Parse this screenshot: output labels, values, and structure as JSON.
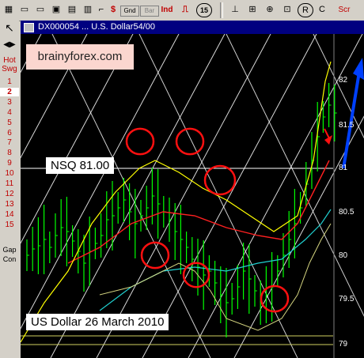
{
  "toolbar": {
    "buttons": [
      {
        "name": "new-chart-icon",
        "glyph": "▦"
      },
      {
        "name": "open-folder-icon",
        "glyph": "📂"
      },
      {
        "name": "open-file-icon",
        "glyph": "🗁"
      },
      {
        "name": "save-icon",
        "glyph": "💾"
      },
      {
        "name": "chart-icon",
        "glyph": "▤"
      },
      {
        "name": "print-icon",
        "glyph": "⎙"
      },
      {
        "name": "dollar-icon",
        "glyph": "$"
      },
      {
        "name": "pointer-icon",
        "glyph": "⚲"
      },
      {
        "name": "text-icon",
        "glyph": "🗏"
      }
    ],
    "tool_gnd": "Gnd",
    "tool_bar": "Bar",
    "ind_label": "Ind",
    "period_label": "15",
    "r_label": "R",
    "c_label": "C",
    "scr_label": "Scr"
  },
  "sidebar": {
    "hot_label": "Hot",
    "swg_label": "Swg",
    "gap_label": "Gap",
    "con_label": "Con",
    "items": [
      "1",
      "2",
      "3",
      "4",
      "5",
      "6",
      "7",
      "8",
      "9",
      "10",
      "11",
      "12",
      "13",
      "14",
      "15"
    ],
    "selected": "2"
  },
  "window": {
    "title": "DX000054 ... U.S. Dollar54/00"
  },
  "chart": {
    "brand": "brainyforex.com",
    "nsq_label": "NSQ 81.00",
    "caption": "US Dollar 26 March 2010",
    "y_axis": [
      "82",
      "81.5",
      "81",
      "80.5",
      "80",
      "79.5",
      "79"
    ],
    "colors": {
      "price": "#00ff00",
      "upper_band": "#ffff00",
      "ma_red": "#ff2020",
      "ma_cyan": "#20d0d0",
      "grid": "#ffffff",
      "circle": "#ff1010",
      "arrow": "#0040ff"
    }
  }
}
